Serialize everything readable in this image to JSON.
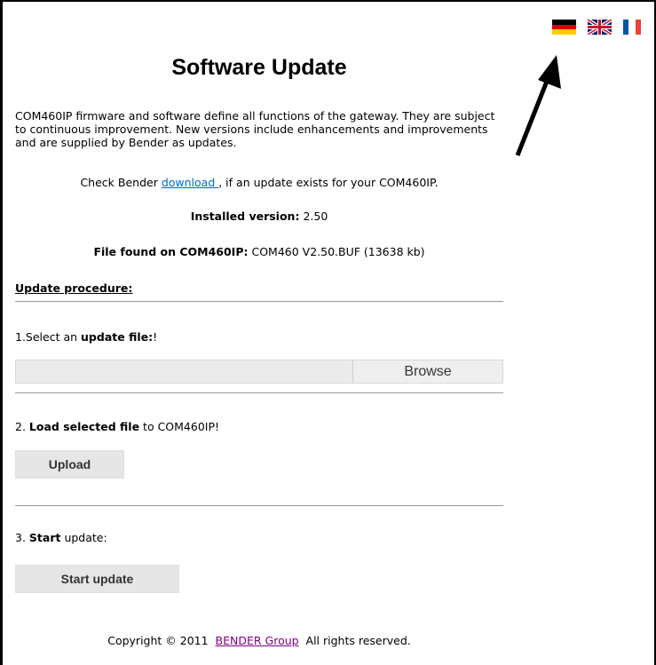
{
  "page": {
    "title": "Software Update",
    "intro": "COM460IP firmware and software define all functions of the gateway. They are subject to continuous improvement. New versions include enhancements and improvements and are supplied by Bender as updates.",
    "check_prefix": "Check Bender ",
    "check_link": "download ",
    "check_suffix": ", if an update exists for your COM460IP.",
    "installed_label": "Installed version:",
    "installed_value": "2.50",
    "file_label": "File found on COM460IP:",
    "file_value": "COM460 V2.50.BUF (13638 kb)",
    "procedure_heading": "Update procedure:"
  },
  "steps": {
    "step1_prefix": "1.Select an ",
    "step1_bold": "update file:",
    "step1_suffix": "!",
    "browse_label": "Browse",
    "step2_prefix": "2. ",
    "step2_bold": "Load selected file",
    "step2_suffix": " to COM460IP!",
    "upload_label": "Upload",
    "step3_prefix": "3. ",
    "step3_bold": "Start",
    "step3_suffix": " update:",
    "start_label": "Start update"
  },
  "footer": {
    "copyright": "Copyright © 2011",
    "company_link": "BENDER Group",
    "rights": "All rights reserved."
  },
  "languages": [
    {
      "icon": "german-flag-icon"
    },
    {
      "icon": "uk-flag-icon"
    },
    {
      "icon": "french-flag-icon"
    }
  ],
  "colors": {
    "link": "#0066cc",
    "visited_link": "#800080",
    "button_bg": "#e6e6e6"
  }
}
